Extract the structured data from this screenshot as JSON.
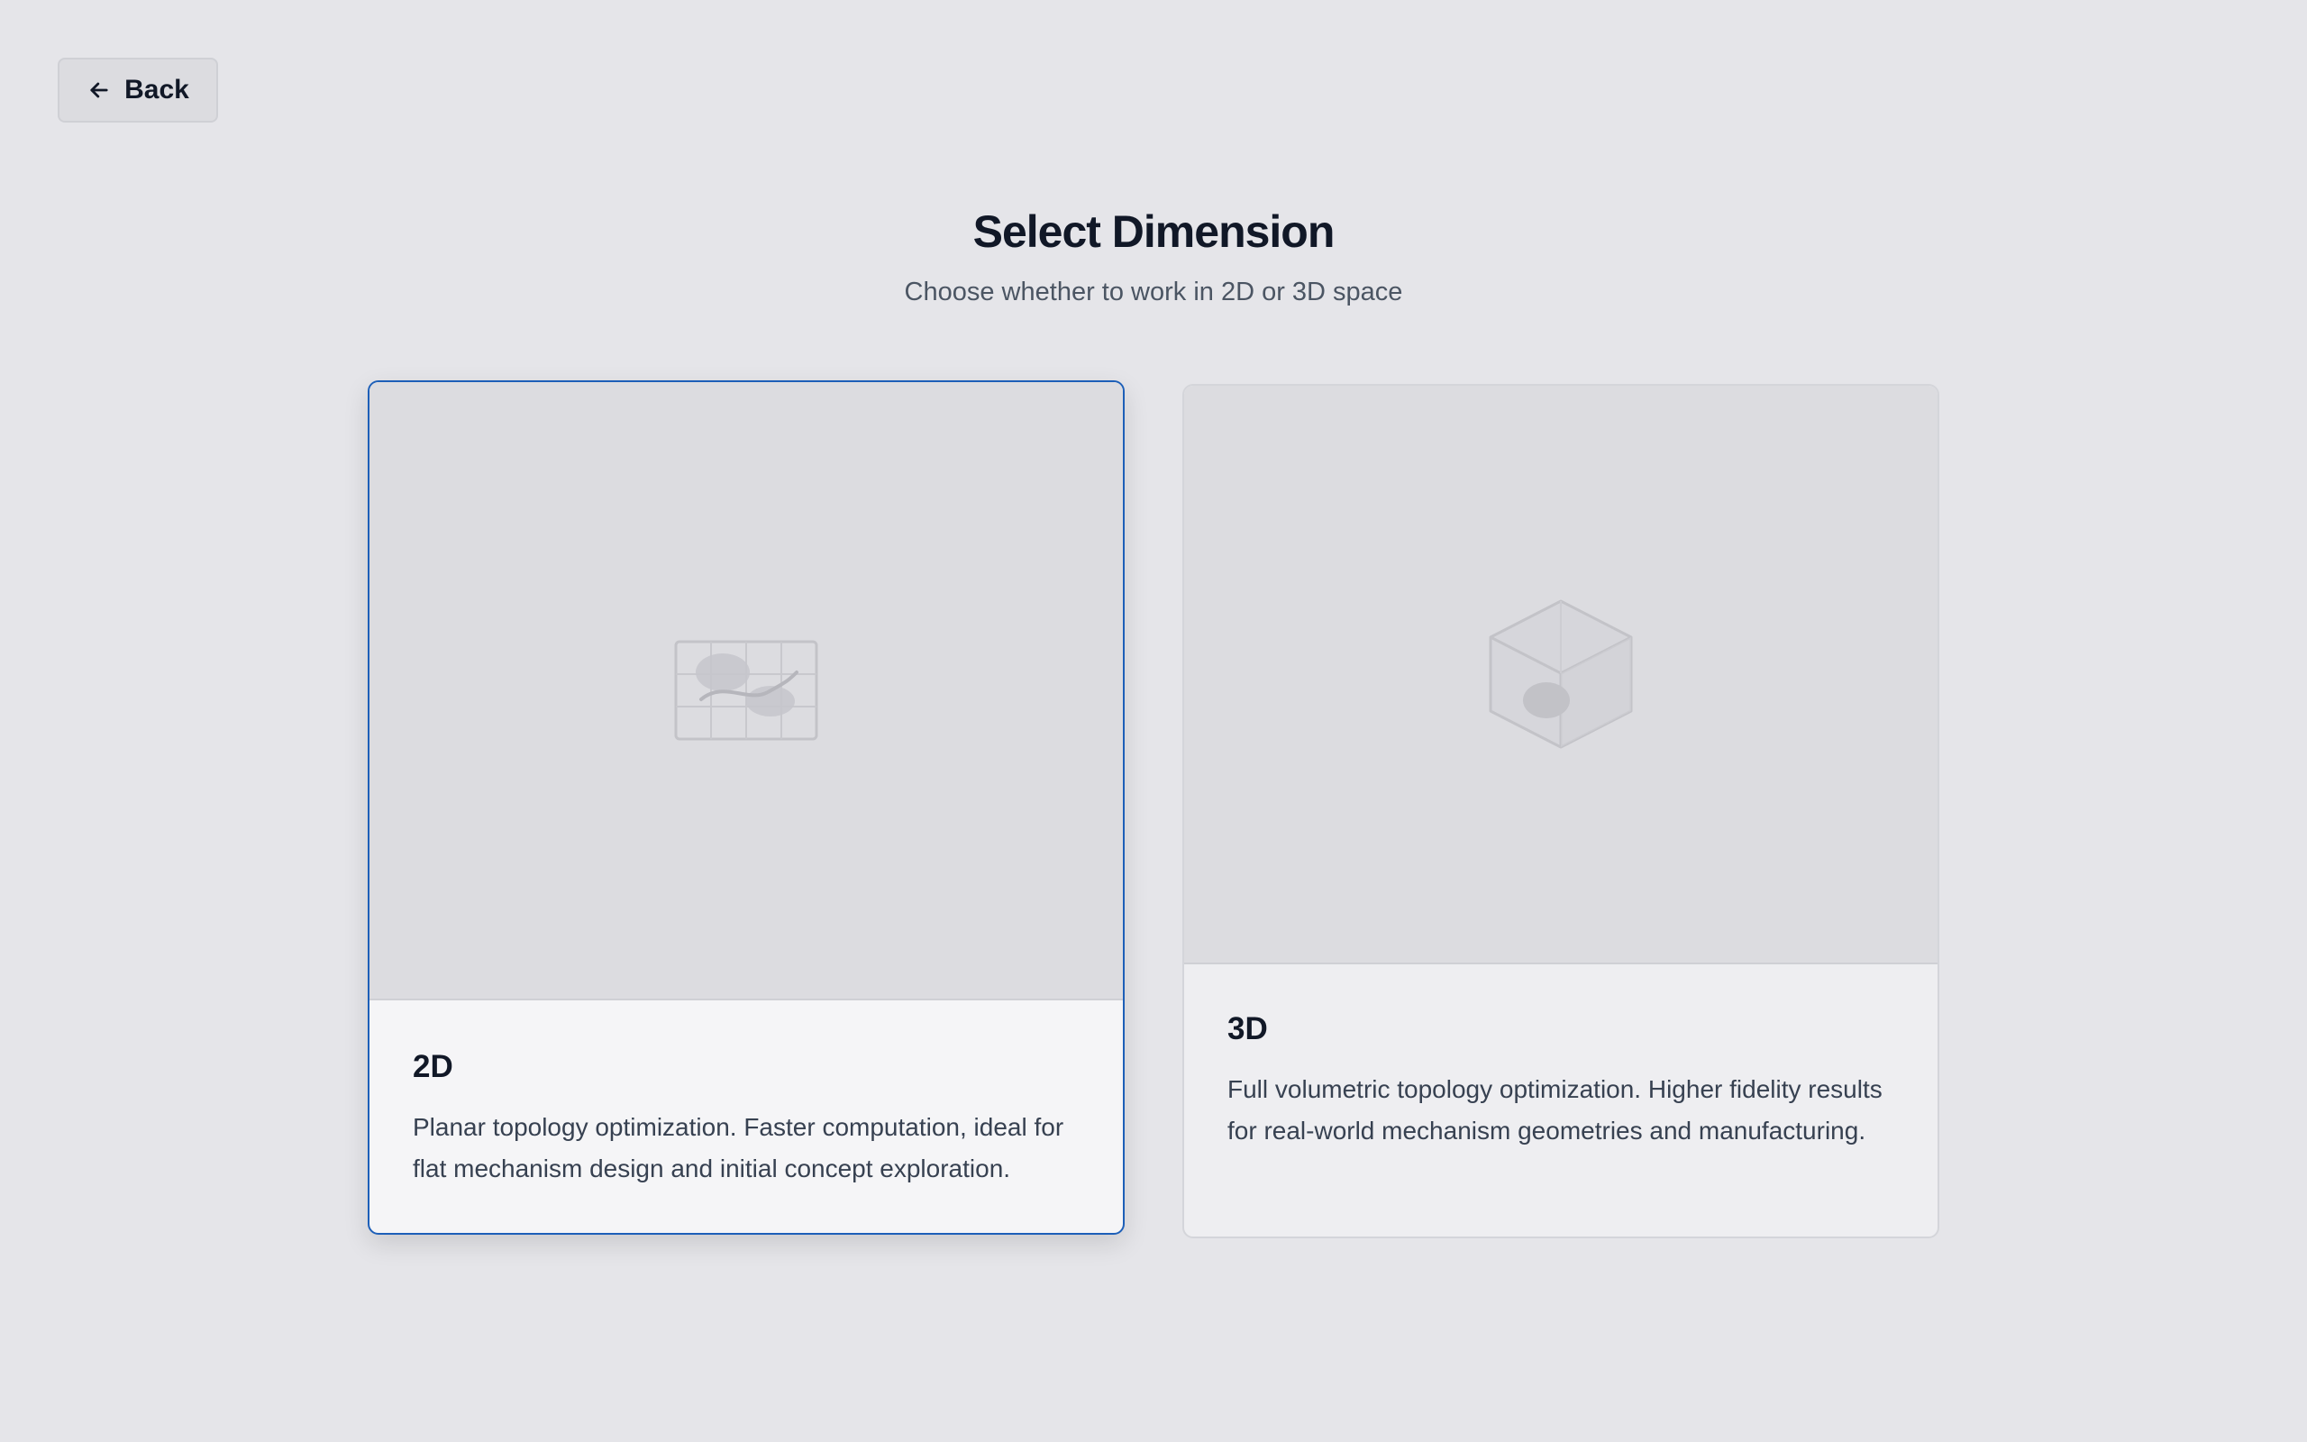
{
  "header": {
    "back_label": "Back",
    "title": "Select Dimension",
    "subtitle": "Choose whether to work in 2D or 3D space"
  },
  "options": [
    {
      "title": "2D",
      "description": "Planar topology optimization. Faster computation, ideal for flat mechanism design and initial concept exploration.",
      "icon": "planar-grid-icon",
      "selected": true
    },
    {
      "title": "3D",
      "description": "Full volumetric topology optimization. Higher fidelity results for real-world mechanism geometries and manufacturing.",
      "icon": "cube-icon",
      "selected": false
    }
  ],
  "colors": {
    "background": "#e5e5e9",
    "accent": "#1d5fb8",
    "text_primary": "#111827",
    "text_secondary": "#4b5563"
  }
}
